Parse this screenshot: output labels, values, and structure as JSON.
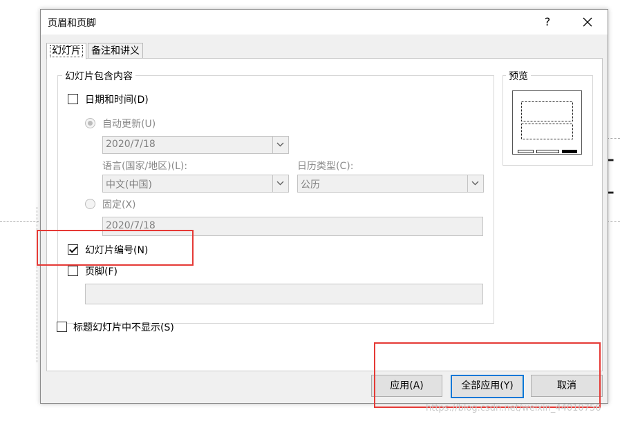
{
  "dialog": {
    "title": "页眉和页脚",
    "help_label": "?",
    "close_label": "✕"
  },
  "tabs": [
    {
      "label": "幻灯片",
      "active": true
    },
    {
      "label": "备注和讲义",
      "active": false
    }
  ],
  "slide_content": {
    "group_label": "幻灯片包含内容",
    "date_time": {
      "label": "日期和时间(D)",
      "checked": false
    },
    "auto_update": {
      "label": "自动更新(U)",
      "selected": true,
      "enabled": false
    },
    "date_combo_value": "2020/7/18",
    "language_label": "语言(国家/地区)(L):",
    "language_value": "中文(中国)",
    "calendar_label": "日历类型(C):",
    "calendar_value": "公历",
    "fixed": {
      "label": "固定(X)",
      "selected": false,
      "enabled": false
    },
    "fixed_value": "2020/7/18",
    "slide_number": {
      "label": "幻灯片编号(N)",
      "checked": true
    },
    "footer": {
      "label": "页脚(F)",
      "checked": false
    },
    "footer_value": ""
  },
  "dont_show_title": {
    "label": "标题幻灯片中不显示(S)",
    "checked": false
  },
  "preview_label": "预览",
  "buttons": {
    "apply": "应用(A)",
    "apply_all": "全部应用(Y)",
    "cancel": "取消"
  },
  "background": {
    "glyph": "[",
    "watermark": "https://blog.csdn.net/weixin_44010756"
  },
  "colors": {
    "highlight": "#e53935",
    "focus": "#0078d7"
  }
}
